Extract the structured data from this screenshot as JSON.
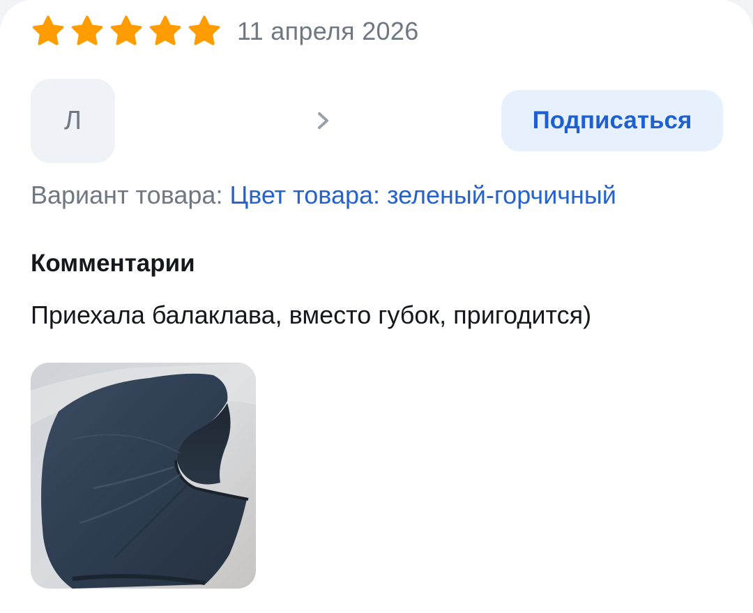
{
  "review": {
    "rating": 5,
    "rating_max": 5,
    "date": "11 апреля 2026",
    "star_color": "#ff9d00"
  },
  "author": {
    "avatar_letter": "Л",
    "name": "",
    "chevron_icon": "chevron-right-icon"
  },
  "subscribe": {
    "label": "Подписаться"
  },
  "variant": {
    "label": "Вариант товара:",
    "value": "Цвет товара: зеленый-горчичный"
  },
  "comments": {
    "title": "Комментарии",
    "text": "Приехала балаклава, вместо губок, пригодится)"
  },
  "photos": [
    {
      "alt_icon": "balaclava-photo"
    }
  ],
  "colors": {
    "accent": "#1f60d1",
    "accent_bg": "#e7f1fd",
    "muted_text": "#6f7782",
    "primary_text": "#14171c"
  }
}
